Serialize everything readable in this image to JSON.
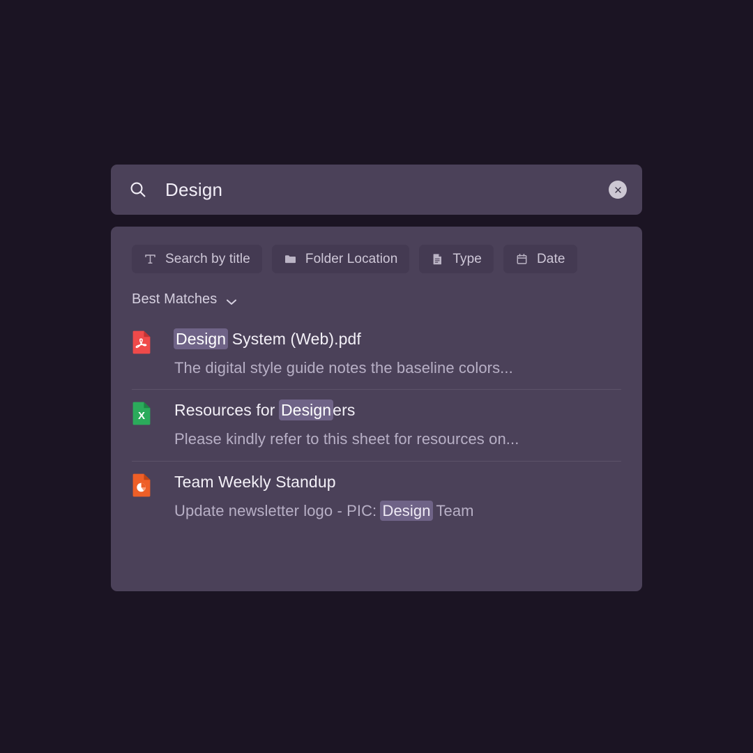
{
  "search": {
    "query": "Design",
    "placeholder": "Search",
    "search_icon": "search-icon",
    "clear_icon": "close-circle-icon"
  },
  "filters": {
    "chips": [
      {
        "label": "Search by title",
        "icon": "text-format-icon"
      },
      {
        "label": "Folder Location",
        "icon": "folder-icon"
      },
      {
        "label": "Type",
        "icon": "document-icon"
      },
      {
        "label": "Date",
        "icon": "calendar-icon"
      }
    ]
  },
  "sort": {
    "label": "Best Matches",
    "icon": "chevron-down-icon"
  },
  "results": [
    {
      "icon": "pdf-file-icon",
      "icon_color": "#ef4a4a",
      "title_parts": [
        {
          "text": "Design",
          "highlight": true
        },
        {
          "text": " System (Web).pdf",
          "highlight": false
        }
      ],
      "subtitle_parts": [
        {
          "text": "The digital style guide notes the baseline colors...",
          "highlight": false
        }
      ]
    },
    {
      "icon": "excel-file-icon",
      "icon_color": "#2bab5b",
      "title_parts": [
        {
          "text": "Resources for ",
          "highlight": false
        },
        {
          "text": "Design",
          "highlight": true
        },
        {
          "text": "ers",
          "highlight": false
        }
      ],
      "subtitle_parts": [
        {
          "text": "Please kindly refer to this sheet for resources on...",
          "highlight": false
        }
      ]
    },
    {
      "icon": "powerpoint-file-icon",
      "icon_color": "#ee5f27",
      "title_parts": [
        {
          "text": "Team Weekly Standup",
          "highlight": false
        }
      ],
      "subtitle_parts": [
        {
          "text": "Update newsletter logo - PIC: ",
          "highlight": false
        },
        {
          "text": "Design",
          "highlight": true
        },
        {
          "text": " Team",
          "highlight": false
        }
      ]
    }
  ],
  "colors": {
    "page_background": "#1b1423",
    "panel_background": "#4b4159",
    "chip_background": "#443a52",
    "highlight": "#6f6387",
    "divider": "#5c5269",
    "primary_text": "#f3f0f7",
    "secondary_text": "#b8b0c6"
  }
}
